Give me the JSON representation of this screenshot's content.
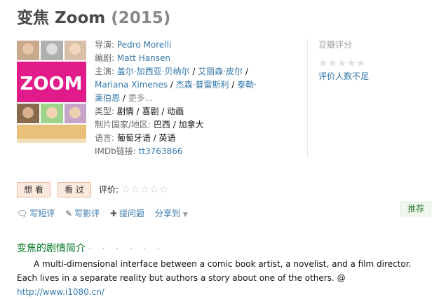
{
  "movie": {
    "title": "变焦 Zoom",
    "year": "(2015)"
  },
  "info": {
    "director_label": "导演: ",
    "director": "Pedro Morelli",
    "writer_label": "编剧: ",
    "writer": "Matt Hansen",
    "cast_label": "主演: ",
    "cast": [
      "盖尔·加西亚·贝纳尔",
      "艾丽森·皮尔",
      "Mariana Ximenes",
      "杰森·普雷斯利",
      "泰勒·莱伯恩"
    ],
    "more": "更多...",
    "genre_label": "类型: ",
    "genres": "剧情 / 喜剧 / 动画",
    "country_label": "制片国家/地区: ",
    "country": "巴西 / 加拿大",
    "language_label": "语言: ",
    "language": "葡萄牙语 / 英语",
    "imdb_label": "IMDb链接: ",
    "imdb": "tt3763866"
  },
  "rating": {
    "title": "豆瓣评分",
    "stars": "★★★★★",
    "not_enough": "评价人数不足"
  },
  "buttons": {
    "want": "想 看",
    "seen": "看 过",
    "rate_label": "评价: ",
    "rate_stars": "☆☆☆☆☆"
  },
  "actions": {
    "short_review": "写短评",
    "review": "写影评",
    "question": "提问题",
    "share": "分享到",
    "recommend": "推荐"
  },
  "intro": {
    "heading": "变焦的剧情简介",
    "dots": "· · · · · ·",
    "text": "A multi-dimensional interface between a comic book artist, a novelist, and a film director. Each lives in a separate reality but authors a story about one of the others. @ ",
    "link": "http://www.i1080.cn/"
  },
  "colors": {
    "link": "#3377aa",
    "heading_green": "#007722",
    "button_bg": "#fbe9dd",
    "poster_pink": "#e21b8a"
  },
  "poster": {
    "text": "ZOOM"
  }
}
